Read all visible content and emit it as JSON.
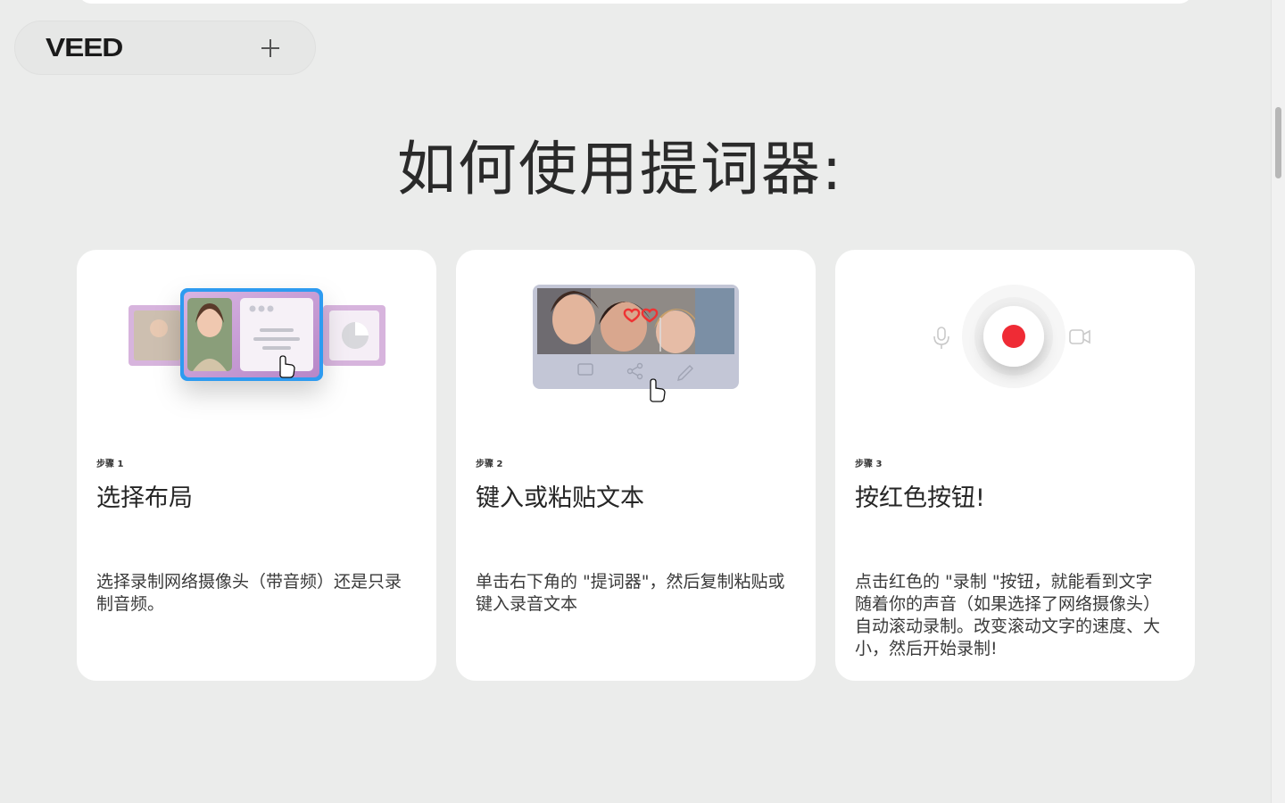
{
  "nav": {
    "logo_text": "VEED",
    "add_icon": "plus-icon"
  },
  "heading": "如何使用提词器:",
  "steps": [
    {
      "step_label": "步骤 1",
      "title": "选择布局",
      "description": "选择录制网络摄像头（带音频）还是只录制音频。"
    },
    {
      "step_label": "步骤 2",
      "title": "键入或粘贴文本",
      "description": "单击右下角的 \"提词器\"，然后复制粘贴或键入录音文本"
    },
    {
      "step_label": "步骤 3",
      "title": "按红色按钮!",
      "description": "点击红色的 \"录制 \"按钮，就能看到文字随着你的声音（如果选择了网络摄像头）自动滚动录制。改变滚动文字的速度、大小，然后开始录制!"
    }
  ],
  "colors": {
    "background": "#ebeceb",
    "card": "#ffffff",
    "accent_blue": "#2f9bf0",
    "record_red": "#ef2b35"
  }
}
